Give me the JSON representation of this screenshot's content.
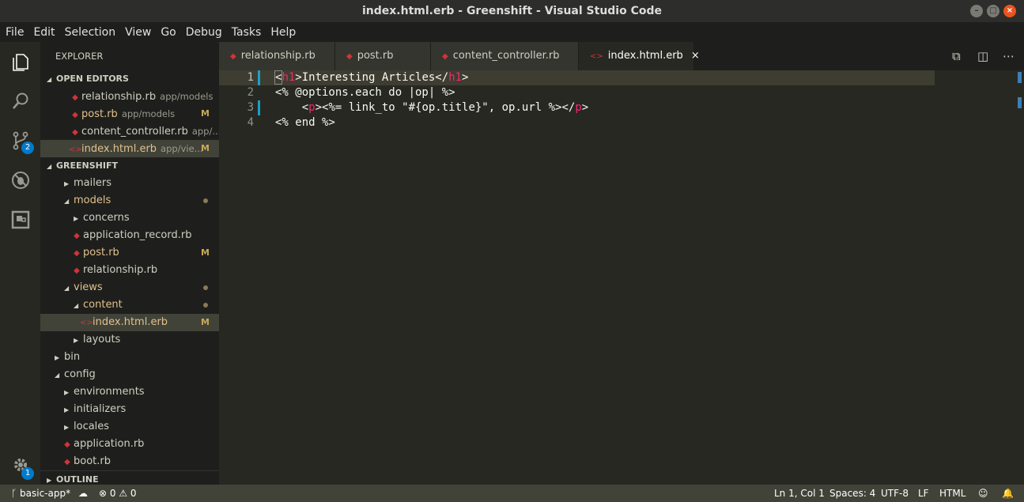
{
  "window": {
    "title": "index.html.erb - Greenshift - Visual Studio Code"
  },
  "menu": [
    "File",
    "Edit",
    "Selection",
    "View",
    "Go",
    "Debug",
    "Tasks",
    "Help"
  ],
  "activity": {
    "scm_badge": "2",
    "settings_badge": "1"
  },
  "explorer": {
    "title": "EXPLORER",
    "open_editors_label": "OPEN EDITORS",
    "open_editors": [
      {
        "name": "relationship.rb",
        "path": "app/models",
        "status": ""
      },
      {
        "name": "post.rb",
        "path": "app/models",
        "status": "M"
      },
      {
        "name": "content_controller.rb",
        "path": "app/...",
        "status": ""
      },
      {
        "name": "index.html.erb",
        "path": "app/vie...",
        "status": "M"
      }
    ],
    "project_label": "GREENSHIFT",
    "tree": [
      {
        "name": "mailers",
        "status": ""
      },
      {
        "name": "models",
        "status": ""
      },
      {
        "name": "concerns",
        "status": ""
      },
      {
        "name": "application_record.rb",
        "status": ""
      },
      {
        "name": "post.rb",
        "status": "M"
      },
      {
        "name": "relationship.rb",
        "status": ""
      },
      {
        "name": "views",
        "status": ""
      },
      {
        "name": "content",
        "status": ""
      },
      {
        "name": "index.html.erb",
        "status": "M"
      },
      {
        "name": "layouts",
        "status": ""
      },
      {
        "name": "bin",
        "status": ""
      },
      {
        "name": "config",
        "status": ""
      },
      {
        "name": "environments",
        "status": ""
      },
      {
        "name": "initializers",
        "status": ""
      },
      {
        "name": "locales",
        "status": ""
      },
      {
        "name": "application.rb",
        "status": ""
      },
      {
        "name": "boot.rb",
        "status": ""
      }
    ],
    "outline_label": "OUTLINE"
  },
  "tabs": [
    {
      "label": "relationship.rb"
    },
    {
      "label": "post.rb"
    },
    {
      "label": "content_controller.rb"
    },
    {
      "label": "index.html.erb",
      "close": "×"
    }
  ],
  "editor": {
    "lines": [
      {
        "num": "1",
        "parts": [
          "<",
          "h1",
          ">Interesting Articles</",
          "h1",
          ">"
        ]
      },
      {
        "num": "2",
        "parts": [
          "<% @options.each do |op| %>"
        ]
      },
      {
        "num": "3",
        "parts": [
          "    <",
          "p",
          "><%= link_to \"#{op.title}\", op.url %></",
          "p",
          ">"
        ]
      },
      {
        "num": "4",
        "parts": [
          "<% end %>"
        ]
      }
    ]
  },
  "status": {
    "branch": "basic-app*",
    "errors": "0",
    "warnings": "0",
    "cursor": "Ln 1, Col 1",
    "spaces": "Spaces: 4",
    "encoding": "UTF-8",
    "eol": "LF",
    "language": "HTML"
  },
  "colors": {
    "accent": "#007acc",
    "tag": "#f92672",
    "modified": "#e2c08d",
    "ruby_icon": "#d0343a"
  }
}
